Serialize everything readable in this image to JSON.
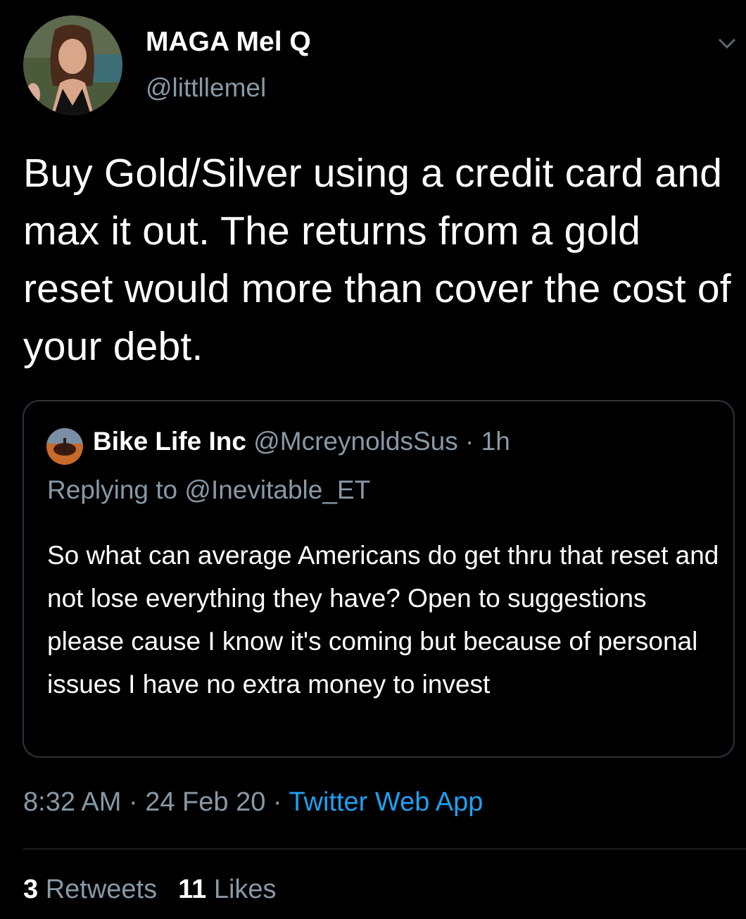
{
  "author": {
    "display_name": "MAGA Mel Q",
    "handle": "@littllemel",
    "avatar_icon": "profile-photo"
  },
  "tweet": {
    "text": "Buy Gold/Silver using a credit card and max it out. The returns from a gold reset would more than cover the cost of your debt."
  },
  "quoted_tweet": {
    "display_name": "Bike Life Inc",
    "handle": "@McreynoldsSus",
    "separator": "·",
    "time_ago": "1h",
    "replying_prefix": "Replying to",
    "replying_to": "@Inevitable_ET",
    "text": "So what can average Americans do get thru that reset and not lose everything they have? Open to suggestions please cause I know it's coming but because of personal issues I have no extra money to invest"
  },
  "meta": {
    "time": "8:32 AM",
    "separator": "·",
    "date": "24 Feb 20",
    "source": "Twitter Web App"
  },
  "stats": {
    "retweets_count": "3",
    "retweets_label": "Retweets",
    "likes_count": "11",
    "likes_label": "Likes"
  },
  "colors": {
    "background": "#000000",
    "primary_text": "#ffffff",
    "secondary_text": "#8899a6",
    "link": "#1da1f2",
    "border": "#2f3336"
  }
}
